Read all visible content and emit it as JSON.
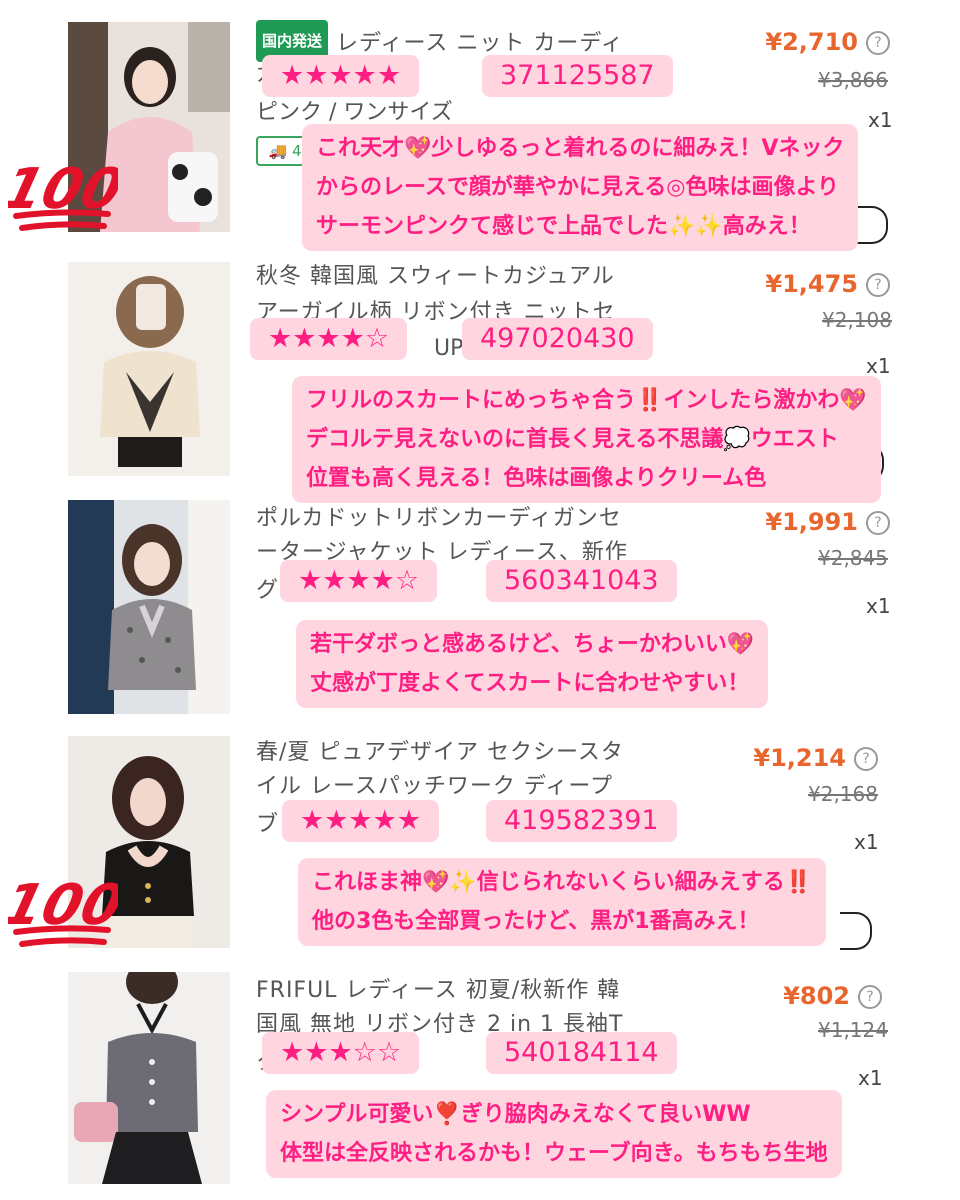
{
  "items": [
    {
      "badge": "国内発送",
      "title_line1": "レディース ニット カーディ",
      "title_line2": "ガン ...ック",
      "variant": "ピンク / ワンサイズ",
      "shipping_chip": "4",
      "price": "¥2,710",
      "original_price": "¥3,866",
      "quantity": "x1",
      "rating": "★★★★★",
      "product_code": "371125587",
      "comment": [
        "これ天才💖少しゆるっと着れるのに細みえ！Vネック",
        "からのレースで顔が華やかに見える◎色味は画像より",
        "サーモンピンクて感じで上品でした✨✨高みえ！"
      ],
      "hundred": true
    },
    {
      "title_line1": "秋冬 韓国風 スウィートカジュアル",
      "title_line2": "アーガイル柄 リボン付き ニットセ",
      "variant_fragment": "UP-",
      "price": "¥1,475",
      "original_price": "¥2,108",
      "quantity": "x1",
      "rating": "★★★★☆",
      "product_code": "497020430",
      "comment": [
        "フリルのスカートにめっちゃ合う‼️インしたら激かわ💖",
        "デコルテ見えないのに首長く見える不思議💭ウエスト",
        "位置も高く見える！色味は画像よりクリーム色"
      ]
    },
    {
      "title_line1": "ポルカドットリボンカーディガンセ",
      "title_line2": "ータージャケット レディース、新作",
      "variant_fragment": "グ",
      "price": "¥1,991",
      "original_price": "¥2,845",
      "quantity": "x1",
      "rating": "★★★★☆",
      "product_code": "560341043",
      "comment": [
        "若干ダボっと感あるけど、ちょーかわいい💖",
        "丈感が丁度よくてスカートに合わせやすい！"
      ]
    },
    {
      "title_line1": "春/夏 ピュアデザイア セクシースタ",
      "title_line2": "イル レースパッチワーク ディープ",
      "variant_fragment": "ブ",
      "price": "¥1,214",
      "original_price": "¥2,168",
      "quantity": "x1",
      "rating": "★★★★★",
      "product_code": "419582391",
      "comment": [
        "これほま神💖✨信じられないくらい細みえする‼️",
        "他の3色も全部買ったけど、黒が1番高みえ！"
      ],
      "hundred": true
    },
    {
      "title_line1": "FRIFUL レディース 初夏/秋新作 韓",
      "title_line2": "国風 無地 リボン付き 2 in 1 長袖T",
      "variant_fragment": "ク",
      "price": "¥802",
      "original_price": "¥1,124",
      "quantity": "x1",
      "rating": "★★★☆☆",
      "product_code": "540184114",
      "comment": [
        "シンプル可愛い❣️ぎり脇肉みえなくて良いWW",
        "体型は全反映されるかも！ウェーブ向き。もちもち生地"
      ]
    }
  ],
  "hundred_text": "100",
  "question_mark": "?",
  "colors": {
    "price": "#e8662d",
    "pill_bg": "#ffd6e0",
    "pill_text": "#ff1f83",
    "domestic_badge": "#1f9b55",
    "hundred_red": "#e3122b"
  },
  "icons": [
    "help-circle-icon",
    "truck-icon",
    "hundred-points-icon"
  ]
}
